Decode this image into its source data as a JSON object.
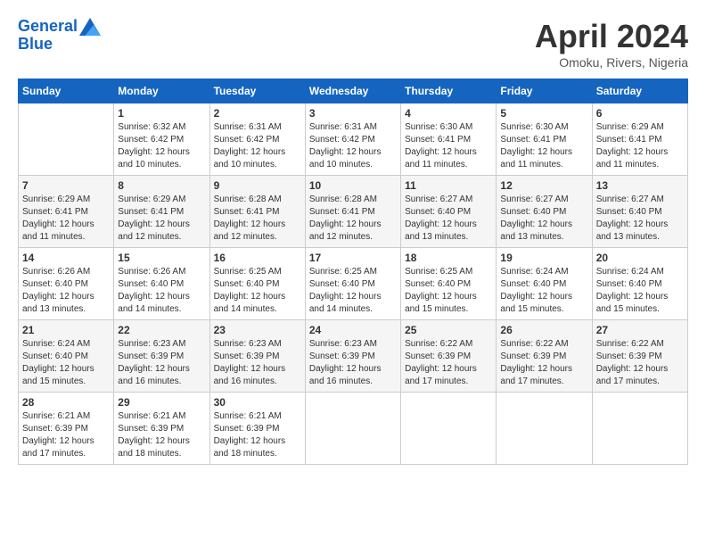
{
  "header": {
    "logo_line1": "General",
    "logo_line2": "Blue",
    "month_title": "April 2024",
    "location": "Omoku, Rivers, Nigeria"
  },
  "days_of_week": [
    "Sunday",
    "Monday",
    "Tuesday",
    "Wednesday",
    "Thursday",
    "Friday",
    "Saturday"
  ],
  "weeks": [
    [
      {
        "day": "",
        "sunrise": "",
        "sunset": "",
        "daylight": ""
      },
      {
        "day": "1",
        "sunrise": "Sunrise: 6:32 AM",
        "sunset": "Sunset: 6:42 PM",
        "daylight": "Daylight: 12 hours and 10 minutes."
      },
      {
        "day": "2",
        "sunrise": "Sunrise: 6:31 AM",
        "sunset": "Sunset: 6:42 PM",
        "daylight": "Daylight: 12 hours and 10 minutes."
      },
      {
        "day": "3",
        "sunrise": "Sunrise: 6:31 AM",
        "sunset": "Sunset: 6:42 PM",
        "daylight": "Daylight: 12 hours and 10 minutes."
      },
      {
        "day": "4",
        "sunrise": "Sunrise: 6:30 AM",
        "sunset": "Sunset: 6:41 PM",
        "daylight": "Daylight: 12 hours and 11 minutes."
      },
      {
        "day": "5",
        "sunrise": "Sunrise: 6:30 AM",
        "sunset": "Sunset: 6:41 PM",
        "daylight": "Daylight: 12 hours and 11 minutes."
      },
      {
        "day": "6",
        "sunrise": "Sunrise: 6:29 AM",
        "sunset": "Sunset: 6:41 PM",
        "daylight": "Daylight: 12 hours and 11 minutes."
      }
    ],
    [
      {
        "day": "7",
        "sunrise": "Sunrise: 6:29 AM",
        "sunset": "Sunset: 6:41 PM",
        "daylight": "Daylight: 12 hours and 11 minutes."
      },
      {
        "day": "8",
        "sunrise": "Sunrise: 6:29 AM",
        "sunset": "Sunset: 6:41 PM",
        "daylight": "Daylight: 12 hours and 12 minutes."
      },
      {
        "day": "9",
        "sunrise": "Sunrise: 6:28 AM",
        "sunset": "Sunset: 6:41 PM",
        "daylight": "Daylight: 12 hours and 12 minutes."
      },
      {
        "day": "10",
        "sunrise": "Sunrise: 6:28 AM",
        "sunset": "Sunset: 6:41 PM",
        "daylight": "Daylight: 12 hours and 12 minutes."
      },
      {
        "day": "11",
        "sunrise": "Sunrise: 6:27 AM",
        "sunset": "Sunset: 6:40 PM",
        "daylight": "Daylight: 12 hours and 13 minutes."
      },
      {
        "day": "12",
        "sunrise": "Sunrise: 6:27 AM",
        "sunset": "Sunset: 6:40 PM",
        "daylight": "Daylight: 12 hours and 13 minutes."
      },
      {
        "day": "13",
        "sunrise": "Sunrise: 6:27 AM",
        "sunset": "Sunset: 6:40 PM",
        "daylight": "Daylight: 12 hours and 13 minutes."
      }
    ],
    [
      {
        "day": "14",
        "sunrise": "Sunrise: 6:26 AM",
        "sunset": "Sunset: 6:40 PM",
        "daylight": "Daylight: 12 hours and 13 minutes."
      },
      {
        "day": "15",
        "sunrise": "Sunrise: 6:26 AM",
        "sunset": "Sunset: 6:40 PM",
        "daylight": "Daylight: 12 hours and 14 minutes."
      },
      {
        "day": "16",
        "sunrise": "Sunrise: 6:25 AM",
        "sunset": "Sunset: 6:40 PM",
        "daylight": "Daylight: 12 hours and 14 minutes."
      },
      {
        "day": "17",
        "sunrise": "Sunrise: 6:25 AM",
        "sunset": "Sunset: 6:40 PM",
        "daylight": "Daylight: 12 hours and 14 minutes."
      },
      {
        "day": "18",
        "sunrise": "Sunrise: 6:25 AM",
        "sunset": "Sunset: 6:40 PM",
        "daylight": "Daylight: 12 hours and 15 minutes."
      },
      {
        "day": "19",
        "sunrise": "Sunrise: 6:24 AM",
        "sunset": "Sunset: 6:40 PM",
        "daylight": "Daylight: 12 hours and 15 minutes."
      },
      {
        "day": "20",
        "sunrise": "Sunrise: 6:24 AM",
        "sunset": "Sunset: 6:40 PM",
        "daylight": "Daylight: 12 hours and 15 minutes."
      }
    ],
    [
      {
        "day": "21",
        "sunrise": "Sunrise: 6:24 AM",
        "sunset": "Sunset: 6:40 PM",
        "daylight": "Daylight: 12 hours and 15 minutes."
      },
      {
        "day": "22",
        "sunrise": "Sunrise: 6:23 AM",
        "sunset": "Sunset: 6:39 PM",
        "daylight": "Daylight: 12 hours and 16 minutes."
      },
      {
        "day": "23",
        "sunrise": "Sunrise: 6:23 AM",
        "sunset": "Sunset: 6:39 PM",
        "daylight": "Daylight: 12 hours and 16 minutes."
      },
      {
        "day": "24",
        "sunrise": "Sunrise: 6:23 AM",
        "sunset": "Sunset: 6:39 PM",
        "daylight": "Daylight: 12 hours and 16 minutes."
      },
      {
        "day": "25",
        "sunrise": "Sunrise: 6:22 AM",
        "sunset": "Sunset: 6:39 PM",
        "daylight": "Daylight: 12 hours and 17 minutes."
      },
      {
        "day": "26",
        "sunrise": "Sunrise: 6:22 AM",
        "sunset": "Sunset: 6:39 PM",
        "daylight": "Daylight: 12 hours and 17 minutes."
      },
      {
        "day": "27",
        "sunrise": "Sunrise: 6:22 AM",
        "sunset": "Sunset: 6:39 PM",
        "daylight": "Daylight: 12 hours and 17 minutes."
      }
    ],
    [
      {
        "day": "28",
        "sunrise": "Sunrise: 6:21 AM",
        "sunset": "Sunset: 6:39 PM",
        "daylight": "Daylight: 12 hours and 17 minutes."
      },
      {
        "day": "29",
        "sunrise": "Sunrise: 6:21 AM",
        "sunset": "Sunset: 6:39 PM",
        "daylight": "Daylight: 12 hours and 18 minutes."
      },
      {
        "day": "30",
        "sunrise": "Sunrise: 6:21 AM",
        "sunset": "Sunset: 6:39 PM",
        "daylight": "Daylight: 12 hours and 18 minutes."
      },
      {
        "day": "",
        "sunrise": "",
        "sunset": "",
        "daylight": ""
      },
      {
        "day": "",
        "sunrise": "",
        "sunset": "",
        "daylight": ""
      },
      {
        "day": "",
        "sunrise": "",
        "sunset": "",
        "daylight": ""
      },
      {
        "day": "",
        "sunrise": "",
        "sunset": "",
        "daylight": ""
      }
    ]
  ]
}
